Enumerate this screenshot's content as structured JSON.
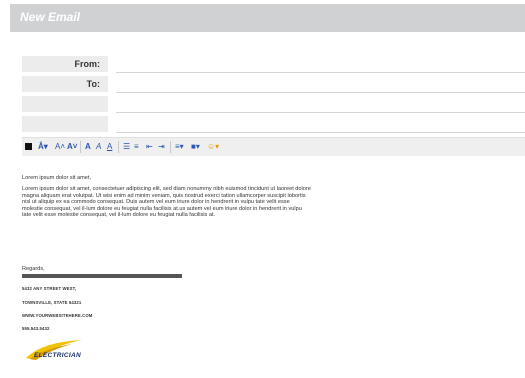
{
  "window": {
    "title": "New Email"
  },
  "fields": {
    "from_label": "From:",
    "to_label": "To:"
  },
  "toolbar": {
    "icons": [
      "text-color-icon",
      "font-size-icon",
      "font-size-increase-icon",
      "font-size-decrease-icon",
      "bold-a-icon",
      "italic-a-icon",
      "underline-a-icon",
      "bullet-list-icon",
      "numbered-list-icon",
      "outdent-icon",
      "indent-icon",
      "align-icon",
      "highlight-icon",
      "emoji-icon"
    ]
  },
  "message": {
    "greeting": "Lorem ipsum dolor sit amet,",
    "paragraph": "Lorem ipsum dolor sit amet, consectetuer adipiscing elit, sed diam nonummy nibh euismod tincidunt ut laoreet dolore magna aliquam erat volutpat. Ut wisi enim ad minim veniam, quis nostrud exerci tation ullamcorper suscipit lobortis nisl ut aliquip ex ea commodo consequat. Duis autem vel eum iriure dolor in hendrerit in vulpu tate velit esse molestie consequat, vel il-lum dolore eu feugiat nulla facilisis at.us autem vel eum iriure dolor in hendrerit in vulpu tate velit esse molestie consequat, vel il-lum dolore eu feugiat nulla facilisis at.",
    "closing": "Regards,"
  },
  "signature": {
    "address1": "5432 ANY STREET WEST,",
    "address2": "TOWNSVILLE, STATE 54321",
    "website": "WWW.YOURWEBSITEHERE.COM",
    "phone": "555.543.5432",
    "logo_text": "ELECTRICIAN"
  },
  "colors": {
    "titlebar": "#d0d1d3",
    "toolbar_icon": "#2a55b0",
    "logo_accent": "#f2c200"
  }
}
